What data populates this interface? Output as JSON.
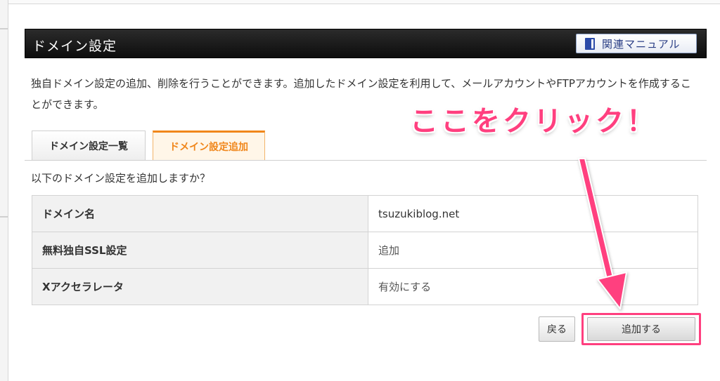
{
  "header": {
    "title": "ドメイン設定",
    "manual_button": "関連マニュアル"
  },
  "description": "独自ドメイン設定の追加、削除を行うことができます。追加したドメイン設定を利用して、メールアカウントやFTPアカウントを作成することができます。",
  "tabs": [
    {
      "label": "ドメイン設定一覧",
      "active": false
    },
    {
      "label": "ドメイン設定追加",
      "active": true
    }
  ],
  "confirm_question": "以下のドメイン設定を追加しますか？",
  "settings": [
    {
      "label": "ドメイン名",
      "value": "tsuzukiblog.net"
    },
    {
      "label": "無料独自SSL設定",
      "value": "追加"
    },
    {
      "label": "Xアクセラレータ",
      "value": "有効にする"
    }
  ],
  "buttons": {
    "back": "戻る",
    "add": "追加する"
  },
  "annotation": {
    "text": "ここをクリック！",
    "color": "#ff3f7f"
  },
  "colors": {
    "header_bg": "#111111",
    "active_tab": "#f0861a",
    "highlight": "#ff3f7f"
  }
}
